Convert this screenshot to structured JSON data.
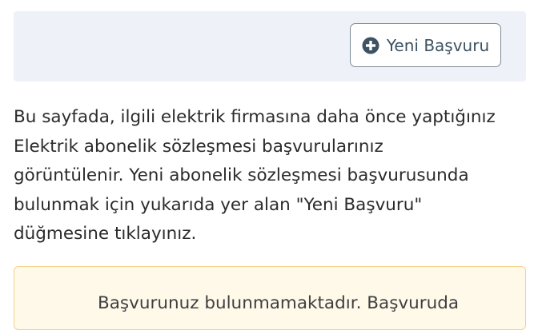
{
  "toolbar": {
    "new_application_label": "Yeni Başvuru",
    "new_application_icon": "plus-circle-icon"
  },
  "intro": {
    "lines": [
      "Bu sayfada, ilgili elektrik firmasına daha önce yaptığınız",
      "Elektrik abonelik sözleşmesi başvurularınız",
      "görüntülenir. Yeni abonelik sözleşmesi başvurusunda",
      "bulunmak için yukarıda yer alan \"Yeni Başvuru\"",
      "düğmesine tıklayınız."
    ]
  },
  "notice": {
    "text": "Başvurunuz bulunmamaktadır. Başvuruda"
  },
  "colors": {
    "panel_bg": "#eef1f7",
    "button_text": "#3d5262",
    "notice_bg": "#fff9ea",
    "notice_border": "#f2d38a"
  }
}
